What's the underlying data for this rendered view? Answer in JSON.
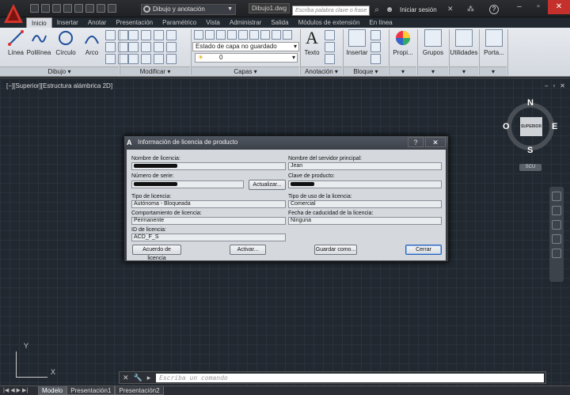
{
  "titlebar": {
    "workspace": "Dibujo y anotación",
    "document": "Dibujo1.dwg",
    "search_placeholder": "Escriba palabra clave o frase",
    "signin": "Iniciar sesión",
    "help": "?"
  },
  "tabs": [
    "Inicio",
    "Insertar",
    "Anotar",
    "Presentación",
    "Paramétrico",
    "Vista",
    "Administrar",
    "Salida",
    "Módulos de extensión",
    "En línea"
  ],
  "ribbon": {
    "draw_tools": [
      "Línea",
      "Polilínea",
      "Círculo",
      "Arco"
    ],
    "panels": {
      "draw": "Dibujo",
      "modify": "Modificar",
      "layers": "Capas",
      "annotation": "Anotación",
      "block": "Bloque"
    },
    "layer_state": "Estado de capa no guardado",
    "layer_current": "0",
    "text_tool": "Texto",
    "insert_tool": "Insertar",
    "right_tools": [
      "Propi...",
      "Grupos",
      "Utilidades",
      "Porta..."
    ]
  },
  "viewport": {
    "label": "[−][Superior][Estructura alámbrica 2D]",
    "controls": [
      "–",
      "▫",
      "✕"
    ]
  },
  "viewcube": {
    "face": "SUPERIOR",
    "north": "N",
    "south": "S",
    "east": "E",
    "west": "O",
    "ucs": "SCU"
  },
  "ucs_icon": {
    "y": "Y",
    "x": "X"
  },
  "command": {
    "placeholder": "Escriba un comando"
  },
  "layout_tabs": [
    "Modelo",
    "Presentación1",
    "Presentación2"
  ],
  "dialog": {
    "title": "Información de licencia de producto",
    "help_btn": "?",
    "close_btn": "✕",
    "fields": {
      "license_name_label": "Nombre de licencia:",
      "server_label": "Nombre del servidor principal:",
      "server_value": "Jean",
      "serial_label": "Número de serie:",
      "product_key_label": "Clave de producto:",
      "license_type_label": "Tipo de licencia:",
      "license_type_value": "Autónoma - Bloqueada",
      "usage_type_label": "Tipo de uso de la licencia:",
      "usage_type_value": "Comercial",
      "behavior_label": "Comportamiento de licencia:",
      "behavior_value": "Permanente",
      "expiry_label": "Fecha de caducidad de la licencia:",
      "expiry_value": "Ninguna",
      "license_id_label": "ID de licencia:",
      "license_id_value": "ACD_F_S"
    },
    "buttons": {
      "update": "Actualizar...",
      "agreement": "Acuerdo de licencia",
      "activate": "Activar...",
      "save_as": "Guardar como...",
      "close": "Cerrar"
    }
  }
}
